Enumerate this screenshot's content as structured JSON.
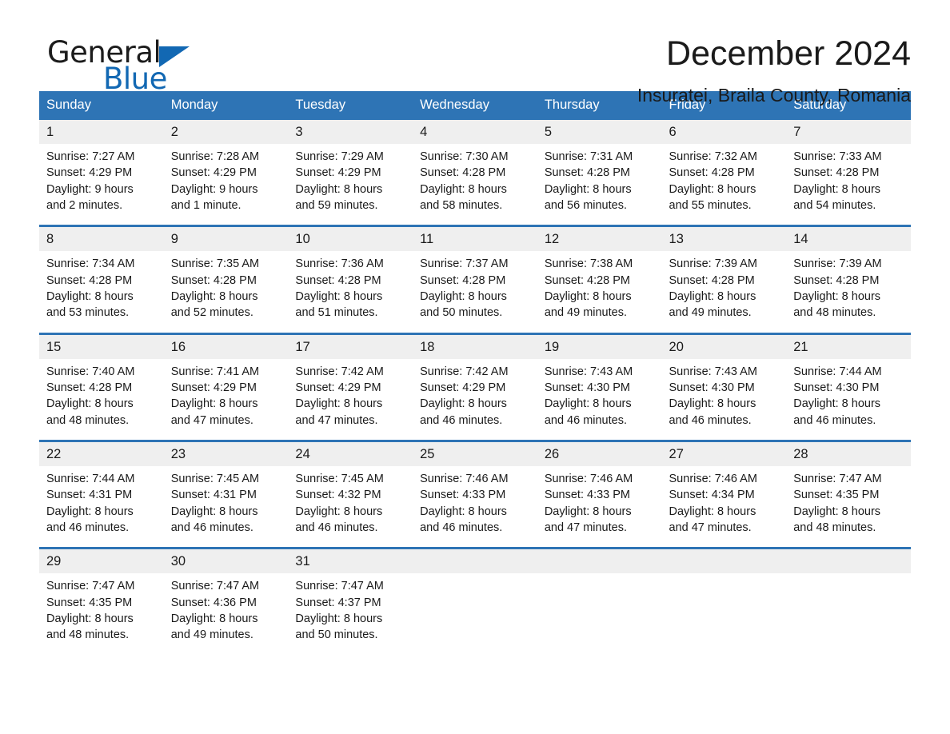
{
  "brand": {
    "name_part1": "General",
    "name_part2": "Blue",
    "triangle_color": "#1268b3"
  },
  "header": {
    "title": "December 2024",
    "subtitle": "Insuratei, Braila County, Romania"
  },
  "theme": {
    "header_blue": "#2e74b5",
    "daynum_gray": "#efefef",
    "text": "#1a1a1a"
  },
  "calendar": {
    "weekday_headers": [
      "Sunday",
      "Monday",
      "Tuesday",
      "Wednesday",
      "Thursday",
      "Friday",
      "Saturday"
    ],
    "weeks": [
      [
        {
          "day": "1",
          "sunrise": "Sunrise: 7:27 AM",
          "sunset": "Sunset: 4:29 PM",
          "daylight_line1": "Daylight: 9 hours",
          "daylight_line2": "and 2 minutes."
        },
        {
          "day": "2",
          "sunrise": "Sunrise: 7:28 AM",
          "sunset": "Sunset: 4:29 PM",
          "daylight_line1": "Daylight: 9 hours",
          "daylight_line2": "and 1 minute."
        },
        {
          "day": "3",
          "sunrise": "Sunrise: 7:29 AM",
          "sunset": "Sunset: 4:29 PM",
          "daylight_line1": "Daylight: 8 hours",
          "daylight_line2": "and 59 minutes."
        },
        {
          "day": "4",
          "sunrise": "Sunrise: 7:30 AM",
          "sunset": "Sunset: 4:28 PM",
          "daylight_line1": "Daylight: 8 hours",
          "daylight_line2": "and 58 minutes."
        },
        {
          "day": "5",
          "sunrise": "Sunrise: 7:31 AM",
          "sunset": "Sunset: 4:28 PM",
          "daylight_line1": "Daylight: 8 hours",
          "daylight_line2": "and 56 minutes."
        },
        {
          "day": "6",
          "sunrise": "Sunrise: 7:32 AM",
          "sunset": "Sunset: 4:28 PM",
          "daylight_line1": "Daylight: 8 hours",
          "daylight_line2": "and 55 minutes."
        },
        {
          "day": "7",
          "sunrise": "Sunrise: 7:33 AM",
          "sunset": "Sunset: 4:28 PM",
          "daylight_line1": "Daylight: 8 hours",
          "daylight_line2": "and 54 minutes."
        }
      ],
      [
        {
          "day": "8",
          "sunrise": "Sunrise: 7:34 AM",
          "sunset": "Sunset: 4:28 PM",
          "daylight_line1": "Daylight: 8 hours",
          "daylight_line2": "and 53 minutes."
        },
        {
          "day": "9",
          "sunrise": "Sunrise: 7:35 AM",
          "sunset": "Sunset: 4:28 PM",
          "daylight_line1": "Daylight: 8 hours",
          "daylight_line2": "and 52 minutes."
        },
        {
          "day": "10",
          "sunrise": "Sunrise: 7:36 AM",
          "sunset": "Sunset: 4:28 PM",
          "daylight_line1": "Daylight: 8 hours",
          "daylight_line2": "and 51 minutes."
        },
        {
          "day": "11",
          "sunrise": "Sunrise: 7:37 AM",
          "sunset": "Sunset: 4:28 PM",
          "daylight_line1": "Daylight: 8 hours",
          "daylight_line2": "and 50 minutes."
        },
        {
          "day": "12",
          "sunrise": "Sunrise: 7:38 AM",
          "sunset": "Sunset: 4:28 PM",
          "daylight_line1": "Daylight: 8 hours",
          "daylight_line2": "and 49 minutes."
        },
        {
          "day": "13",
          "sunrise": "Sunrise: 7:39 AM",
          "sunset": "Sunset: 4:28 PM",
          "daylight_line1": "Daylight: 8 hours",
          "daylight_line2": "and 49 minutes."
        },
        {
          "day": "14",
          "sunrise": "Sunrise: 7:39 AM",
          "sunset": "Sunset: 4:28 PM",
          "daylight_line1": "Daylight: 8 hours",
          "daylight_line2": "and 48 minutes."
        }
      ],
      [
        {
          "day": "15",
          "sunrise": "Sunrise: 7:40 AM",
          "sunset": "Sunset: 4:28 PM",
          "daylight_line1": "Daylight: 8 hours",
          "daylight_line2": "and 48 minutes."
        },
        {
          "day": "16",
          "sunrise": "Sunrise: 7:41 AM",
          "sunset": "Sunset: 4:29 PM",
          "daylight_line1": "Daylight: 8 hours",
          "daylight_line2": "and 47 minutes."
        },
        {
          "day": "17",
          "sunrise": "Sunrise: 7:42 AM",
          "sunset": "Sunset: 4:29 PM",
          "daylight_line1": "Daylight: 8 hours",
          "daylight_line2": "and 47 minutes."
        },
        {
          "day": "18",
          "sunrise": "Sunrise: 7:42 AM",
          "sunset": "Sunset: 4:29 PM",
          "daylight_line1": "Daylight: 8 hours",
          "daylight_line2": "and 46 minutes."
        },
        {
          "day": "19",
          "sunrise": "Sunrise: 7:43 AM",
          "sunset": "Sunset: 4:30 PM",
          "daylight_line1": "Daylight: 8 hours",
          "daylight_line2": "and 46 minutes."
        },
        {
          "day": "20",
          "sunrise": "Sunrise: 7:43 AM",
          "sunset": "Sunset: 4:30 PM",
          "daylight_line1": "Daylight: 8 hours",
          "daylight_line2": "and 46 minutes."
        },
        {
          "day": "21",
          "sunrise": "Sunrise: 7:44 AM",
          "sunset": "Sunset: 4:30 PM",
          "daylight_line1": "Daylight: 8 hours",
          "daylight_line2": "and 46 minutes."
        }
      ],
      [
        {
          "day": "22",
          "sunrise": "Sunrise: 7:44 AM",
          "sunset": "Sunset: 4:31 PM",
          "daylight_line1": "Daylight: 8 hours",
          "daylight_line2": "and 46 minutes."
        },
        {
          "day": "23",
          "sunrise": "Sunrise: 7:45 AM",
          "sunset": "Sunset: 4:31 PM",
          "daylight_line1": "Daylight: 8 hours",
          "daylight_line2": "and 46 minutes."
        },
        {
          "day": "24",
          "sunrise": "Sunrise: 7:45 AM",
          "sunset": "Sunset: 4:32 PM",
          "daylight_line1": "Daylight: 8 hours",
          "daylight_line2": "and 46 minutes."
        },
        {
          "day": "25",
          "sunrise": "Sunrise: 7:46 AM",
          "sunset": "Sunset: 4:33 PM",
          "daylight_line1": "Daylight: 8 hours",
          "daylight_line2": "and 46 minutes."
        },
        {
          "day": "26",
          "sunrise": "Sunrise: 7:46 AM",
          "sunset": "Sunset: 4:33 PM",
          "daylight_line1": "Daylight: 8 hours",
          "daylight_line2": "and 47 minutes."
        },
        {
          "day": "27",
          "sunrise": "Sunrise: 7:46 AM",
          "sunset": "Sunset: 4:34 PM",
          "daylight_line1": "Daylight: 8 hours",
          "daylight_line2": "and 47 minutes."
        },
        {
          "day": "28",
          "sunrise": "Sunrise: 7:47 AM",
          "sunset": "Sunset: 4:35 PM",
          "daylight_line1": "Daylight: 8 hours",
          "daylight_line2": "and 48 minutes."
        }
      ],
      [
        {
          "day": "29",
          "sunrise": "Sunrise: 7:47 AM",
          "sunset": "Sunset: 4:35 PM",
          "daylight_line1": "Daylight: 8 hours",
          "daylight_line2": "and 48 minutes."
        },
        {
          "day": "30",
          "sunrise": "Sunrise: 7:47 AM",
          "sunset": "Sunset: 4:36 PM",
          "daylight_line1": "Daylight: 8 hours",
          "daylight_line2": "and 49 minutes."
        },
        {
          "day": "31",
          "sunrise": "Sunrise: 7:47 AM",
          "sunset": "Sunset: 4:37 PM",
          "daylight_line1": "Daylight: 8 hours",
          "daylight_line2": "and 50 minutes."
        },
        {
          "day": "",
          "sunrise": "",
          "sunset": "",
          "daylight_line1": "",
          "daylight_line2": ""
        },
        {
          "day": "",
          "sunrise": "",
          "sunset": "",
          "daylight_line1": "",
          "daylight_line2": ""
        },
        {
          "day": "",
          "sunrise": "",
          "sunset": "",
          "daylight_line1": "",
          "daylight_line2": ""
        },
        {
          "day": "",
          "sunrise": "",
          "sunset": "",
          "daylight_line1": "",
          "daylight_line2": ""
        }
      ]
    ]
  }
}
